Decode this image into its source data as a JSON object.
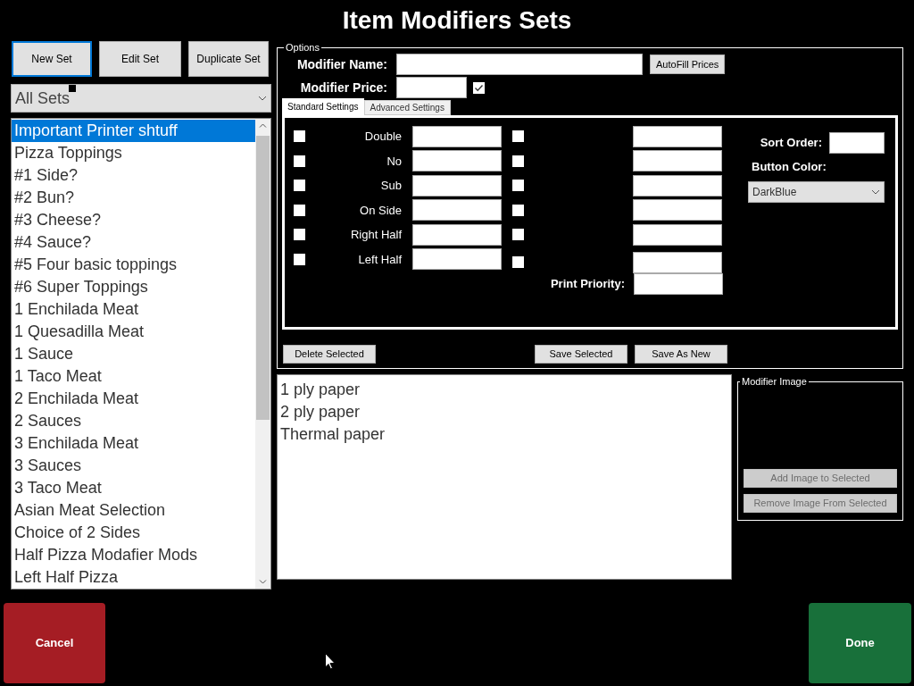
{
  "title": "Item Modifiers Sets",
  "toolbar": [
    {
      "label": "New Set",
      "focused": true
    },
    {
      "label": "Edit Set",
      "focused": false
    },
    {
      "label": "Duplicate Set",
      "focused": false
    }
  ],
  "set_filter": {
    "value": "All Sets"
  },
  "sets": [
    {
      "label": "Important Printer shtuff",
      "selected": true
    },
    {
      "label": "Pizza Toppings",
      "selected": false
    },
    {
      "label": "#1 Side?",
      "selected": false
    },
    {
      "label": "#2 Bun?",
      "selected": false
    },
    {
      "label": "#3 Cheese?",
      "selected": false
    },
    {
      "label": "#4 Sauce?",
      "selected": false
    },
    {
      "label": "#5 Four basic toppings",
      "selected": false
    },
    {
      "label": "#6 Super Toppings",
      "selected": false
    },
    {
      "label": "1 Enchilada Meat",
      "selected": false
    },
    {
      "label": "1 Quesadilla Meat",
      "selected": false
    },
    {
      "label": "1 Sauce",
      "selected": false
    },
    {
      "label": "1 Taco Meat",
      "selected": false
    },
    {
      "label": "2 Enchilada Meat",
      "selected": false
    },
    {
      "label": "2 Sauces",
      "selected": false
    },
    {
      "label": "3 Enchilada Meat",
      "selected": false
    },
    {
      "label": "3 Sauces",
      "selected": false
    },
    {
      "label": "3 Taco Meat",
      "selected": false
    },
    {
      "label": "Asian Meat Selection",
      "selected": false
    },
    {
      "label": "Choice of 2 Sides",
      "selected": false
    },
    {
      "label": "Half Pizza Modafier Mods",
      "selected": false
    },
    {
      "label": "Left Half Pizza",
      "selected": false
    }
  ],
  "options": {
    "legend": "Options",
    "modifier_name": {
      "label": "Modifier Name:"
    },
    "autofill_button": "AutoFill Prices",
    "modifier_price": {
      "label": "Modifier Price:",
      "checked": true
    },
    "tabs": [
      {
        "label": "Standard Settings",
        "selected": true
      },
      {
        "label": "Advanced Settings",
        "selected": false
      }
    ],
    "settings": [
      {
        "label": "Double",
        "checked": false,
        "extra_checked": false
      },
      {
        "label": "No",
        "checked": false,
        "extra_checked": false
      },
      {
        "label": "Sub",
        "checked": false,
        "extra_checked": false
      },
      {
        "label": "On Side",
        "checked": false,
        "extra_checked": false
      },
      {
        "label": "Right Half",
        "checked": false,
        "extra_checked": false
      },
      {
        "label": "Left Half",
        "checked": false,
        "extra_checked": false
      }
    ],
    "print_priority": {
      "label": "Print Priority:"
    },
    "sort_order": {
      "label": "Sort Order:"
    },
    "button_color": {
      "label": "Button Color:",
      "value": "DarkBlue"
    },
    "actions": [
      "Delete Selected",
      "Save Selected",
      "Save As New"
    ]
  },
  "modifiers": [
    "1 ply paper",
    "2 ply paper",
    "Thermal paper"
  ],
  "modifier_image": {
    "legend": "Modifier Image",
    "buttons": [
      {
        "label": "Add Image to Selected",
        "disabled": true
      },
      {
        "label": "Remove Image From Selected",
        "disabled": true
      }
    ]
  },
  "footer": {
    "cancel": "Cancel",
    "done": "Done"
  }
}
